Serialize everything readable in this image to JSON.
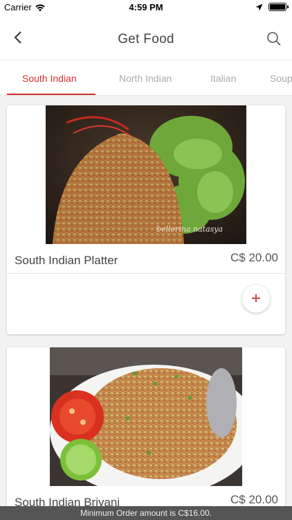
{
  "status_bar": {
    "carrier": "Carrier",
    "time": "4:59 PM",
    "icons": [
      "wifi-icon",
      "location-arrow-icon",
      "battery-icon"
    ]
  },
  "nav": {
    "title": "Get Food",
    "back_icon": "chevron-left-icon",
    "search_icon": "search-icon"
  },
  "tabs": [
    {
      "label": "South Indian",
      "active": true
    },
    {
      "label": "North Indian",
      "active": false
    },
    {
      "label": "Italian",
      "active": false
    },
    {
      "label": "Soup",
      "active": false
    }
  ],
  "items": [
    {
      "name": "South Indian Platter",
      "price": "C$ 20.00",
      "add_label": "+",
      "image": "fried-rice-with-lettuce-photo",
      "watermark": "bellerina natasya"
    },
    {
      "name": "South Indian Briyani",
      "price": "C$ 20.00",
      "image": "fried-rice-with-tomato-and-lime-photo"
    }
  ],
  "footer": {
    "min_order_text": "Minimum Order amount is C$16.00."
  },
  "colors": {
    "accent": "#d32f2f",
    "background": "#f2f2f2",
    "footer": "#555555"
  }
}
